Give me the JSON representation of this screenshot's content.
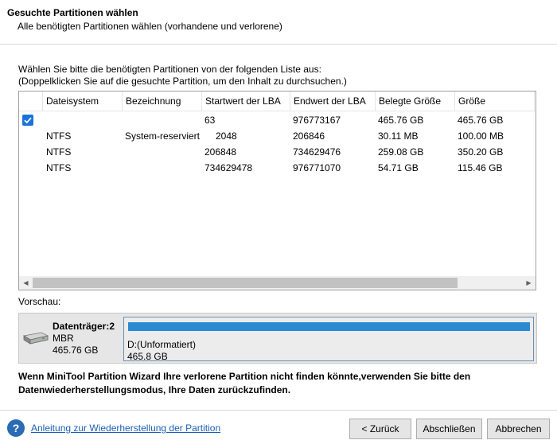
{
  "header": {
    "title": "Gesuchte Partitionen wählen",
    "subtitle": "Alle benötigten Partitionen wählen (vorhandene und verlorene)"
  },
  "instructions": {
    "line1": "Wählen Sie bitte die benötigten Partitionen von der folgenden Liste aus:",
    "line2": "(Doppelklicken Sie auf die gesuchte Partition, um den Inhalt zu durchsuchen.)"
  },
  "table": {
    "columns": [
      "Dateisystem",
      "Bezeichnung",
      "Startwert der LBA",
      "Endwert der LBA",
      "Belegte Größe",
      "Größe"
    ],
    "rows": [
      {
        "checked": true,
        "filesystem": "",
        "label": "",
        "start_lba": "63",
        "end_lba": "976773167",
        "used": "465.76 GB",
        "size": "465.76 GB"
      },
      {
        "checked": false,
        "filesystem": "NTFS",
        "label": "System-reserviert",
        "start_lba": "2048",
        "end_lba": "206846",
        "used": "30.11 MB",
        "size": "100.00 MB"
      },
      {
        "checked": false,
        "filesystem": "NTFS",
        "label": "",
        "start_lba": "206848",
        "end_lba": "734629476",
        "used": "259.08 GB",
        "size": "350.20 GB"
      },
      {
        "checked": false,
        "filesystem": "NTFS",
        "label": "",
        "start_lba": "734629478",
        "end_lba": "976771070",
        "used": "54.71 GB",
        "size": "115.46 GB"
      }
    ]
  },
  "preview": {
    "label": "Vorschau:",
    "disk_name": "Datenträger:2",
    "disk_type": "MBR",
    "disk_size": "465.76 GB",
    "partition_label": "D:(Unformatiert)",
    "partition_size": "465.8 GB",
    "partition_color": "#2a8bd1"
  },
  "warning": "Wenn MiniTool Partition Wizard Ihre verlorene Partition nicht finden könnte,verwenden Sie bitte den Datenwiederherstellungsmodus, Ihre Daten zurückzufinden.",
  "footer": {
    "help_icon": "question-icon",
    "help_link": "Anleitung zur Wiederherstellung der Partition",
    "back": "< Zurück",
    "finish": "Abschließen",
    "cancel": "Abbrechen"
  }
}
